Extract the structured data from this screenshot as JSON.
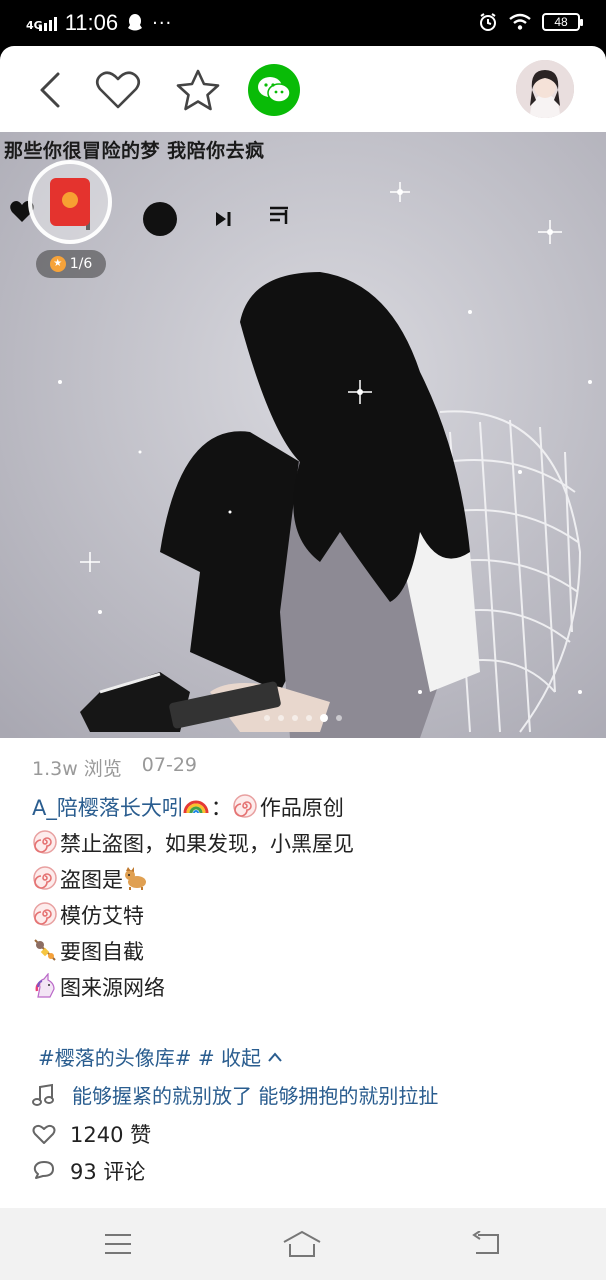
{
  "status_bar": {
    "network": "4G",
    "time": "11:06",
    "more": "···",
    "battery": "48"
  },
  "top_bar": {
    "icons": [
      "back-icon",
      "heart-icon",
      "star-icon",
      "wechat-icon"
    ],
    "accent": "#09bb07"
  },
  "photo": {
    "caption": "那些你很冒险的梦 我陪你去疯",
    "pager_total": 6,
    "pager_active": 5
  },
  "red_packet": {
    "count": "1/6"
  },
  "post": {
    "views": "1.3w 浏览",
    "date": "07-29",
    "author": "A_陪樱落长大吲",
    "author_suffix": "：",
    "line1_text": "作品原创",
    "line2": "禁止盗图，如果发现，小黑屋见",
    "line3": "盗图是",
    "line4": "模仿艾特",
    "line5": "要图自截",
    "line6": "图来源网络",
    "tags": "#樱落的头像库# # 收起",
    "music": "能够握紧的就别放了 能够拥抱的就别拉扯",
    "likes": "1240 赞",
    "comments": "93 评论"
  },
  "nav_bar": {
    "icons": [
      "menu-icon",
      "home-icon",
      "back-nav-icon"
    ]
  }
}
